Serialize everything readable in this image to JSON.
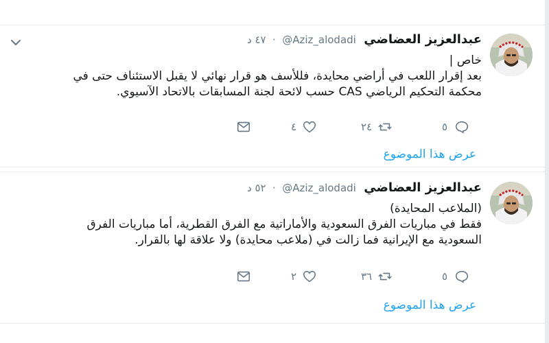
{
  "tweets": [
    {
      "name": "عبدالعزيز العضاضي",
      "handle": "@Aziz_alodadi",
      "separator": "·",
      "time": "٤٧ د",
      "lines": [
        "خاص |",
        "بعد إقرار اللعب في أراضي محايدة، فللأسف هو قرار نهائي لا يقبل الاستئناف حتى في",
        "محكمة التحكيم الرياضي CAS حسب لائحة لجنة المسابقات بالاتحاد الآسيوي."
      ],
      "replies": "٥",
      "retweets": "٢٤",
      "likes": "٤",
      "thread_link": "عرض هذا الموضوع",
      "has_menu": true
    },
    {
      "name": "عبدالعزيز العضاضي",
      "handle": "@Aziz_alodadi",
      "separator": "·",
      "time": "٥٢ د",
      "lines": [
        "(الملاعب المحايدة)",
        "فقط في مباريات الفرق السعودية والأماراتية مع الفرق القطرية، أما مباريات الفرق",
        "السعودية مع الإيرانية فما زالت في (ملاعب محايدة) ولا علاقة لها بالقرار."
      ],
      "replies": "٥",
      "retweets": "٣٦",
      "likes": "٢",
      "thread_link": "عرض هذا الموضوع",
      "has_menu": false
    }
  ],
  "colors": {
    "text": "#14171a",
    "muted": "#657786",
    "link": "#1da1f2",
    "border": "#e6ecf0"
  },
  "icons": [
    "reply-icon",
    "retweet-icon",
    "like-icon",
    "direct-message-icon",
    "chevron-down-icon"
  ]
}
